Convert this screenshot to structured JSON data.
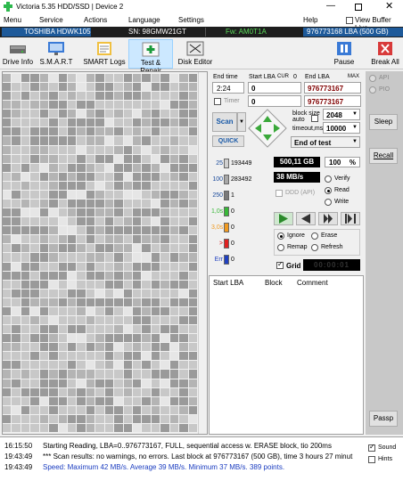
{
  "window": {
    "title": "Victoria 5.35 HDD/SSD | Device 2"
  },
  "menu": [
    "Menu",
    "Service",
    "Actions",
    "Language",
    "Settings",
    "Help"
  ],
  "view_buffer": "View Buffer Live",
  "info": {
    "model": "TOSHIBA HDWK105",
    "serial": "SN: 98GMW21GT",
    "firmware": "Fw: AM0T1A",
    "capacity": "976773168 LBA (500 GB)"
  },
  "toolbar": {
    "drive_info": "Drive Info",
    "smart": "S.M.A.R.T",
    "smart_logs": "SMART Logs",
    "test_repair": "Test & Repair",
    "disk_editor": "Disk Editor",
    "pause": "Pause",
    "break_all": "Break All"
  },
  "controls": {
    "end_time_label": "End time",
    "start_lba_label": "Start LBA",
    "cur_label": "CUR",
    "cur_value": "0",
    "end_lba_label": "End LBA",
    "max_label": "MAX",
    "time_value": "2:24",
    "start_lba": "0",
    "end_lba": "976773167",
    "timer_label": "Timer",
    "timer_value": "0",
    "end_lba2": "976773167",
    "scan_label": "Scan",
    "quick_label": "QUICK",
    "block_size_label": "block size",
    "auto_label": "auto",
    "block_size": "2048",
    "timeout_label": "timeout,ms",
    "timeout": "10000",
    "end_of_test": "End of test"
  },
  "counters": [
    {
      "label": "25",
      "value": "193449",
      "color": "#d0d0d0"
    },
    {
      "label": "100",
      "value": "283492",
      "color": "#a8a8a8"
    },
    {
      "label": "250",
      "value": "1",
      "color": "#7a7a7a"
    },
    {
      "label": "1,0s",
      "value": "0",
      "color": "#38b838"
    },
    {
      "label": "3,0s",
      "value": "0",
      "color": "#f09a20"
    },
    {
      "label": ">",
      "value": "0",
      "color": "#e02020"
    },
    {
      "label": "Err",
      "value": "0",
      "color": "#2040c0"
    }
  ],
  "stats": {
    "size": "500,11 GB",
    "percent": "100",
    "percent_unit": "%",
    "speed": "38 MB/s"
  },
  "modes": {
    "ddd": "DDD (API)",
    "verify": "Verify",
    "read": "Read",
    "write": "Write",
    "selected": "Read"
  },
  "repair": {
    "ignore": "Ignore",
    "erase": "Erase",
    "remap": "Remap",
    "refresh": "Refresh",
    "selected": "Ignore"
  },
  "grid": {
    "label": "Grid",
    "clock": "00:00:01"
  },
  "table": {
    "columns": [
      "Start LBA",
      "Block",
      "Comment"
    ]
  },
  "side": {
    "api": "API",
    "pio": "PIO",
    "sleep": "Sleep",
    "recall": "Recall",
    "passp": "Passp"
  },
  "log": [
    {
      "time": "16:15:50",
      "msg": "Starting Reading, LBA=0..976773167, FULL, sequential access w. ERASE block, tio 200ms",
      "color": "#000000"
    },
    {
      "time": "19:43:49",
      "msg": "*** Scan results: no warnings, no errors. Last block at 976773167 (500 GB), time 3 hours 27 minut",
      "color": "#000000"
    },
    {
      "time": "19:43:49",
      "msg": "Speed: Maximum 42 MB/s. Average 39 MB/s. Minimum 37 MB/s. 389 points.",
      "color": "#1a3cc0"
    }
  ],
  "sound": {
    "sound_label": "Sound",
    "hints_label": "Hints"
  }
}
